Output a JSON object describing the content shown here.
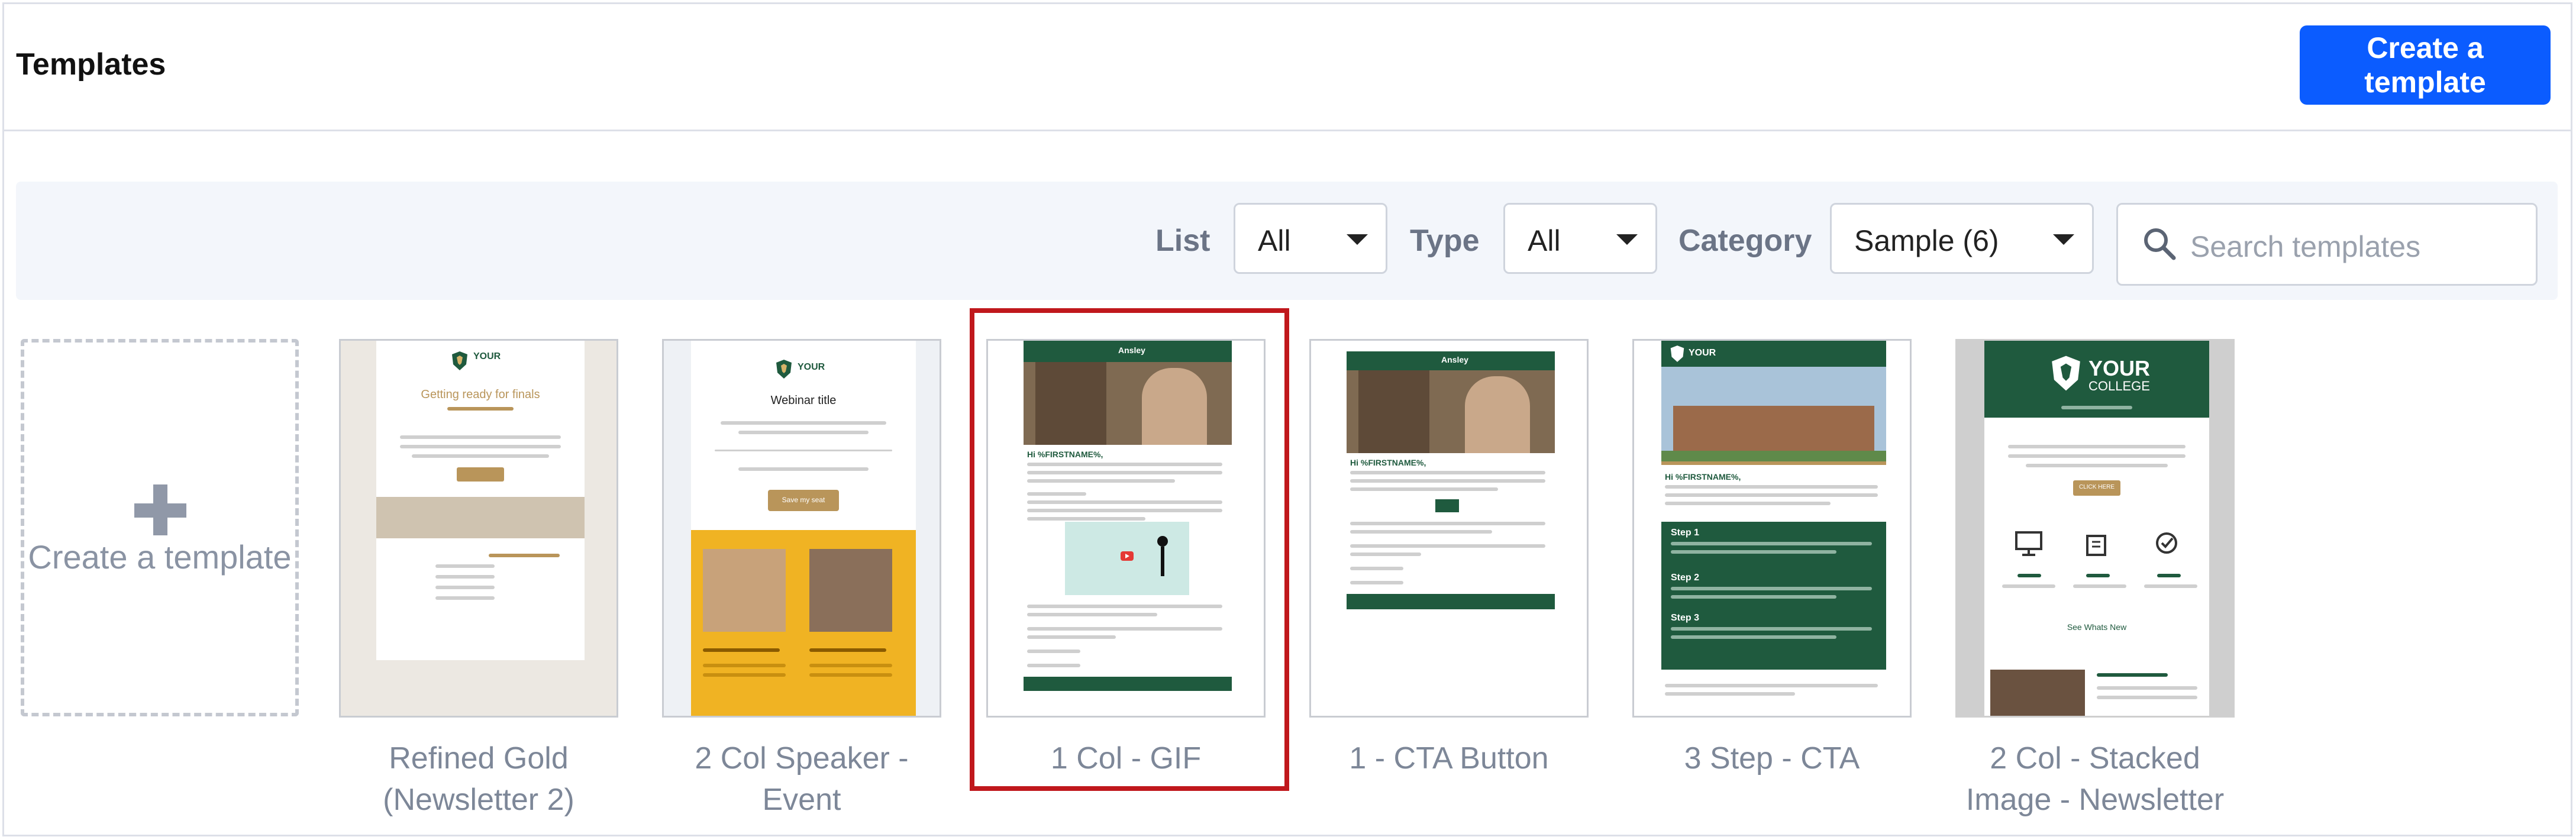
{
  "header": {
    "title": "Templates",
    "create_button": "Create a template"
  },
  "filters": {
    "list_label": "List",
    "list_value": "All",
    "type_label": "Type",
    "type_value": "All",
    "category_label": "Category",
    "category_value": "Sample (6)",
    "search_placeholder": "Search templates"
  },
  "create_tile": {
    "label": "Create a template"
  },
  "templates": [
    {
      "name": "Refined Gold (Newsletter 2)",
      "line1": "Refined Gold",
      "line2": "(Newsletter 2)",
      "selected": false
    },
    {
      "name": "2 Col Speaker - Event",
      "line1": "2 Col Speaker -",
      "line2": "Event",
      "selected": false
    },
    {
      "name": "1 Col - GIF",
      "line1": "1 Col - GIF",
      "line2": "",
      "selected": true
    },
    {
      "name": "1 - CTA Button",
      "line1": "1 - CTA Button",
      "line2": "",
      "selected": false
    },
    {
      "name": "3 Step - CTA",
      "line1": "3 Step - CTA",
      "line2": "",
      "selected": false
    },
    {
      "name": "2 Col - Stacked Image - Newsletter",
      "line1": "2 Col - Stacked",
      "line2": "Image - Newsletter",
      "selected": false
    }
  ],
  "thumb_text": {
    "your_college": "YOUR",
    "college": "COLLEGE",
    "finals_heading": "Getting ready for finals",
    "webinar_title": "Webinar title",
    "save_seat": "Save my seat",
    "ansley": "Ansley",
    "hi_firstname": "Hi %FIRSTNAME%,",
    "step1": "Step 1",
    "step2": "Step 2",
    "step3": "Step 3",
    "click_here": "CLICK HERE",
    "see_whats_new": "See Whats New"
  },
  "colors": {
    "primary": "#0b5cff",
    "selected_border": "#c0181c",
    "brand_green": "#1f5a3e",
    "brand_gold": "#b9955a"
  }
}
